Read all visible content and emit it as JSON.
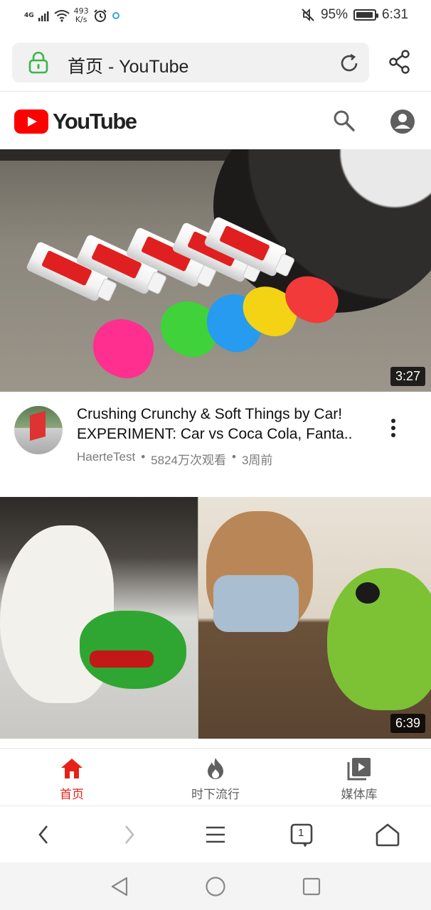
{
  "status_bar": {
    "signal": "4G",
    "net_speed_value": "493",
    "net_speed_unit": "K/s",
    "battery_text": "95%",
    "battery_level": 0.95,
    "time": "6:31"
  },
  "browser": {
    "address_text": "首页 - YouTube"
  },
  "youtube": {
    "logo_text": "YouTube",
    "videos": [
      {
        "duration": "3:27",
        "title_line1": "Crushing Crunchy & Soft Things by Car!",
        "title_line2": "EXPERIMENT: Car vs Coca Cola, Fanta..",
        "channel": "HaerteTest",
        "sep1": "•",
        "views": "5824万次观看",
        "sep2": "•",
        "age": "3周前"
      },
      {
        "duration": "6:39"
      }
    ],
    "nav": {
      "home": "首页",
      "trending": "时下流行",
      "library": "媒体库"
    }
  },
  "browser_toolbar": {
    "tab_count": "1"
  },
  "colors": {
    "brand_red": "#ff0000",
    "active_nav": "#e62117",
    "lock_green": "#3ab54a"
  }
}
